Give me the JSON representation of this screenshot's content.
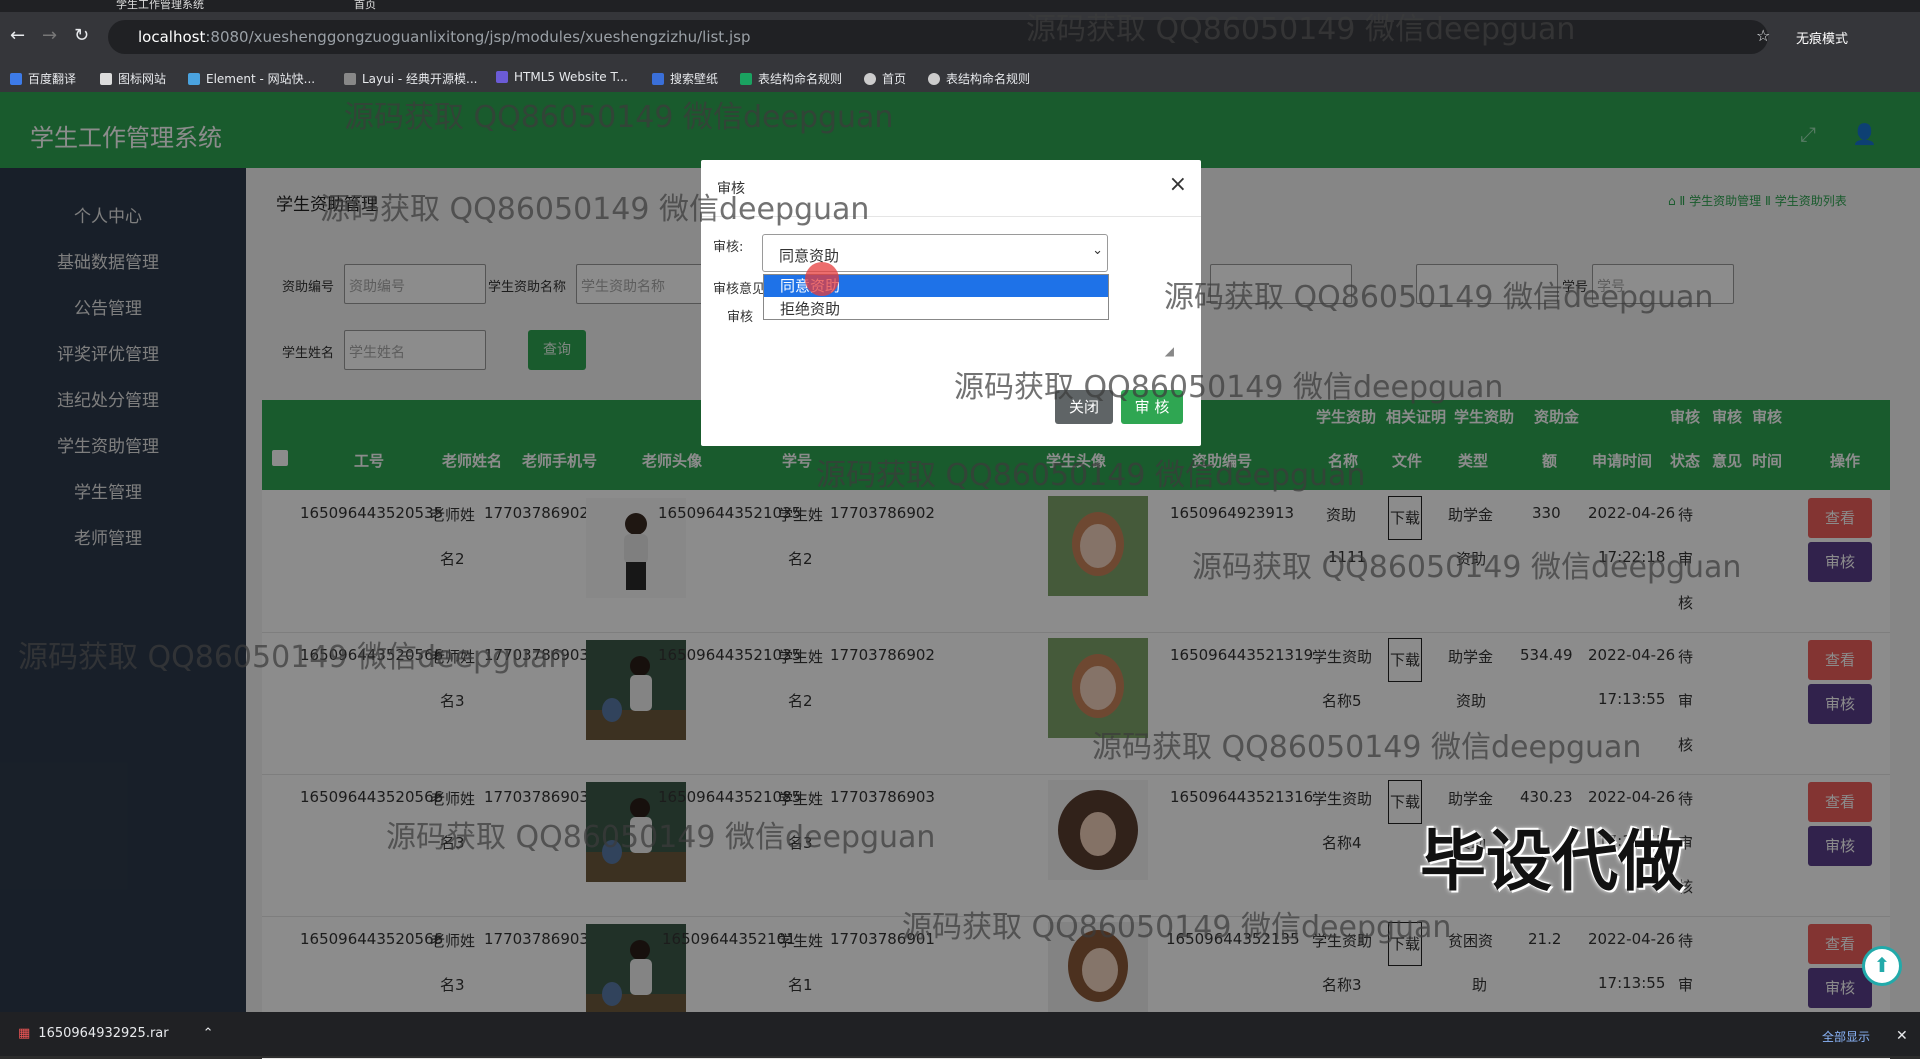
{
  "browser": {
    "tabs": [
      "学生工作管理系统",
      "首页"
    ],
    "url_host": "localhost",
    "url_path": ":8080/xueshenggongzuoguanlixitong/jsp/modules/xueshengzizhu/list.jsp",
    "incognito": "无痕模式",
    "bookmarks": [
      "百度翻译",
      "图标网站",
      "Element - 网站快...",
      "Layui - 经典开源模...",
      "HTML5 Website T...",
      "搜索壁纸",
      "表结构命名规则",
      "首页",
      "表结构命名规则"
    ]
  },
  "app": {
    "title": "学生工作管理系统",
    "sidebar": [
      "个人中心",
      "基础数据管理",
      "公告管理",
      "评奖评优管理",
      "违纪处分管理",
      "学生资助管理",
      "学生管理",
      "老师管理"
    ],
    "section_title": "学生资助管理",
    "breadcrumb": "⌂ Ⅱ 学生资助管理 Ⅱ 学生资助列表",
    "filters": {
      "code_label": "资助编号",
      "code_placeholder": "资助编号",
      "name_label": "学生资助名称",
      "name_placeholder": "学生资助名称",
      "student_label": "学生姓名",
      "student_placeholder": "学生姓名",
      "query_btn": "查询",
      "extra1": "学号",
      "extra_placeholder": "学号"
    },
    "table_headers": {
      "gonghao": "工号",
      "teacher_name": "老师姓名",
      "teacher_phone": "老师手机号",
      "teacher_avatar": "老师头像",
      "xuehao": "学号",
      "student_avatar": "学生头像",
      "code": "资助编号",
      "name_top": "学生资助",
      "name_bottom": "名称",
      "doc_top": "相关证明",
      "doc_bottom": "文件",
      "type_top": "学生资助",
      "type_bottom": "类型",
      "amount_top": "资助金",
      "amount_bottom": "额",
      "time": "申请时间",
      "s1_top": "审核",
      "s1_bottom": "状态",
      "s2_top": "审核",
      "s2_bottom": "意见",
      "s3_top": "审核",
      "s3_bottom": "时间",
      "ops": "操作"
    },
    "rows": [
      {
        "gonghao": "165096443520535",
        "tname1": "老师姓",
        "tname2": "名2",
        "tphone": "17703786902",
        "xuehao": "165096443521035",
        "sname1": "学生姓",
        "sname2": "名2",
        "sphone": "17703786902",
        "code": "1650964923913",
        "zname1": "资助",
        "zname2": "1111",
        "dl": "下载",
        "type1": "助学金",
        "type2": "资助",
        "amount": "330",
        "date": "2022-04-26",
        "time": "17:22:18",
        "st1": "待",
        "st2": "审",
        "st3": "核",
        "view": "查看",
        "audit": "审核"
      },
      {
        "gonghao": "165096443520566",
        "tname1": "老师姓",
        "tname2": "名3",
        "tphone": "17703786903",
        "xuehao": "165096443521035",
        "sname1": "学生姓",
        "sname2": "名2",
        "sphone": "17703786902",
        "code": "165096443521319",
        "zname1": "学生资助",
        "zname2": "名称5",
        "dl": "下载",
        "type1": "助学金",
        "type2": "资助",
        "amount": "534.49",
        "date": "2022-04-26",
        "time": "17:13:55",
        "st1": "待",
        "st2": "审",
        "st3": "核",
        "view": "查看",
        "audit": "审核"
      },
      {
        "gonghao": "165096443520566",
        "tname1": "老师姓",
        "tname2": "名3",
        "tphone": "17703786903",
        "xuehao": "165096443521085",
        "sname1": "学生姓",
        "sname2": "名3",
        "sphone": "17703786903",
        "code": "165096443521316",
        "zname1": "学生资助",
        "zname2": "名称4",
        "dl": "下载",
        "type1": "助学金",
        "type2": "资助",
        "amount": "430.23",
        "date": "2022-04-26",
        "time": "17:13:55",
        "st1": "待",
        "st2": "审",
        "st3": "核",
        "view": "查看",
        "audit": "审核"
      },
      {
        "gonghao": "165096443520566",
        "tname1": "老师姓",
        "tname2": "名3",
        "tphone": "17703786903",
        "xuehao": "16509644352101",
        "sname1": "学生姓",
        "sname2": "名1",
        "sphone": "17703786901",
        "code": "16509644352135",
        "zname1": "学生资助",
        "zname2": "名称3",
        "dl": "下载",
        "type1": "贫困资",
        "type2": "助",
        "amount": "21.2",
        "date": "2022-04-26",
        "time": "17:13:55",
        "st1": "待",
        "st2": "审",
        "st3": "核",
        "view": "查看",
        "audit": "审核"
      }
    ]
  },
  "modal": {
    "title": "审核",
    "close": "×",
    "status_label": "审核:",
    "opinion_label": "审核意见",
    "opinion_label2": "审核",
    "selected": "同意资助",
    "options": [
      "同意资助",
      "拒绝资助"
    ],
    "close_btn": "关闭",
    "submit_btn": "审 核"
  },
  "watermark": "源码获取 QQ86050149 微信deepguan",
  "watermark_big": "毕设代做",
  "download": {
    "file": "1650964932925.rar",
    "show_all": "全部显示"
  },
  "colors": {
    "brand_green": "#2fa652",
    "sidebar": "#2d3a4b",
    "view_btn": "#ee5f5b",
    "audit_btn": "#5a3f8a"
  }
}
